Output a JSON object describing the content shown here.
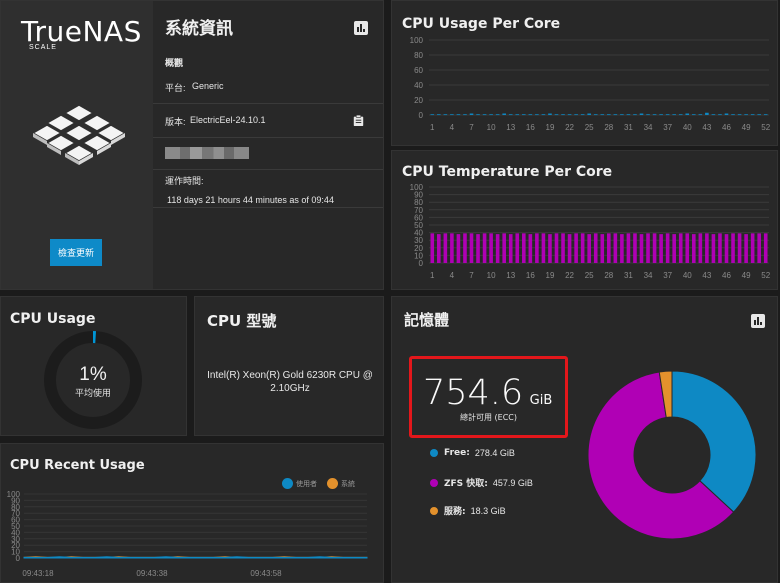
{
  "brand": {
    "name": "TrueNAS",
    "edition": "SCALE"
  },
  "sysinfo": {
    "title": "系統資訊",
    "overview_label": "概觀",
    "platform_label": "平台:",
    "platform_value": "Generic",
    "version_label": "版本:",
    "version_value": "ElectricEel-24.10.1",
    "uptime_label": "運作時間:",
    "uptime_value": "118 days 21 hours 44 minutes as of 09:44",
    "update_button": "檢查更新",
    "icons": [
      "bar-chart-icon",
      "clipboard-icon"
    ]
  },
  "cpu_usage": {
    "title": "CPU Usage",
    "percent": "1%",
    "percent_value": 1,
    "caption": "平均使用",
    "colors": {
      "used": "#0095d5",
      "track": "#1c1c1c"
    }
  },
  "cpu_model": {
    "title": "CPU 型號",
    "model": "Intel(R) Xeon(R) Gold 6230R CPU @ 2.10GHz"
  },
  "memory": {
    "title": "記憶體",
    "total_value": "754.6",
    "total_unit": "GiB",
    "total_caption": "總計可用 (ECC)",
    "legend": [
      {
        "label": "Free:",
        "value": "278.4 GiB",
        "color": "#0e89c4"
      },
      {
        "label": "ZFS 快取:",
        "value": "457.9 GiB",
        "color": "#b000b5"
      },
      {
        "label": "服務:",
        "value": "18.3 GiB",
        "color": "#e3912c"
      }
    ]
  },
  "chart_data": [
    {
      "type": "bar",
      "title": "CPU Usage Per Core",
      "ylim": [
        0,
        100
      ],
      "yticks": [
        0,
        20,
        40,
        60,
        80,
        100
      ],
      "xticks": [
        "1",
        "4",
        "7",
        "10",
        "13",
        "16",
        "19",
        "22",
        "25",
        "28",
        "31",
        "34",
        "37",
        "40",
        "43",
        "46",
        "49",
        "52"
      ],
      "values": [
        1,
        1,
        1,
        1,
        1,
        1,
        2,
        1,
        1,
        1,
        1,
        2,
        1,
        1,
        1,
        1,
        1,
        1,
        2,
        1,
        1,
        1,
        1,
        1,
        2,
        1,
        1,
        1,
        1,
        1,
        1,
        1,
        2,
        1,
        1,
        1,
        1,
        1,
        1,
        2,
        1,
        1,
        3,
        1,
        1,
        2,
        1,
        1,
        1,
        1,
        1,
        1
      ],
      "color": "#0e89c4",
      "grid": true
    },
    {
      "type": "bar",
      "title": "CPU Temperature Per Core",
      "ylim": [
        0,
        100
      ],
      "yticks": [
        0,
        10,
        20,
        30,
        40,
        50,
        60,
        70,
        80,
        90,
        100
      ],
      "xticks": [
        "1",
        "4",
        "7",
        "10",
        "13",
        "16",
        "19",
        "22",
        "25",
        "28",
        "31",
        "34",
        "37",
        "40",
        "43",
        "46",
        "49",
        "52"
      ],
      "values": [
        39,
        38,
        39,
        39,
        38,
        39,
        39,
        38,
        39,
        39,
        38,
        39,
        38,
        39,
        39,
        38,
        39,
        39,
        38,
        39,
        39,
        38,
        39,
        39,
        38,
        39,
        38,
        39,
        39,
        38,
        39,
        39,
        38,
        39,
        39,
        38,
        39,
        38,
        39,
        39,
        38,
        39,
        39,
        38,
        39,
        38,
        39,
        39,
        38,
        39,
        39,
        39
      ],
      "color": "#b000b5",
      "grid": true
    },
    {
      "type": "area",
      "title": "CPU Recent Usage",
      "ylim": [
        0,
        100
      ],
      "yticks": [
        0,
        10,
        20,
        30,
        40,
        50,
        60,
        70,
        80,
        90,
        100
      ],
      "x": [
        "09:43:18",
        "09:43:38",
        "09:43:58"
      ],
      "series": [
        {
          "name": "使用者",
          "color": "#0e89c4",
          "values": [
            1,
            1,
            1,
            2,
            1,
            1,
            1,
            2,
            1,
            1,
            1,
            1,
            2,
            1,
            1,
            1,
            1,
            1,
            2,
            1,
            1,
            1,
            1,
            1,
            1,
            2,
            1,
            1,
            1,
            1
          ]
        },
        {
          "name": "系統",
          "color": "#e3912c",
          "values": [
            1,
            2,
            1,
            1,
            2,
            1,
            1,
            1,
            2,
            1,
            1,
            1,
            1,
            2,
            1,
            1,
            1,
            2,
            1,
            1,
            1,
            1,
            2,
            1,
            1,
            1,
            2,
            1,
            1,
            1
          ]
        }
      ],
      "legend_position": "top-right",
      "grid": true
    },
    {
      "type": "pie",
      "title": "記憶體",
      "categories": [
        "Free",
        "ZFS 快取",
        "服務"
      ],
      "values": [
        278.4,
        457.9,
        18.3
      ],
      "colors": [
        "#0e89c4",
        "#b000b5",
        "#e3912c"
      ]
    }
  ]
}
